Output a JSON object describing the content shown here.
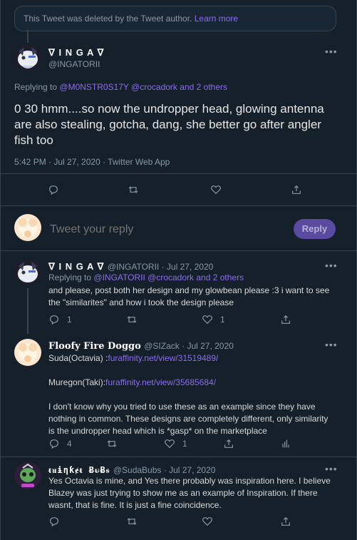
{
  "deleted_notice": {
    "text": "This Tweet was deleted by the Tweet author.",
    "link": "Learn more"
  },
  "main_tweet": {
    "display_name": "ᐁ I N G A ᐁ",
    "handle": "@INGATORII",
    "replying_prefix": "Replying to",
    "replying_users": "@M0NSTR0S17Y @crocadork",
    "replying_others": "and 2 others",
    "text": "0 30 hmm....so now the undropper head, glowing antenna are also stealing, gotcha, dang, she better go after angler fish too",
    "meta": "5:42 PM · Jul 27, 2020 · Twitter Web App"
  },
  "composer": {
    "placeholder": "Tweet your reply",
    "button": "Reply"
  },
  "replies": [
    {
      "display_name": "ᐁ I N G A ᐁ",
      "handle_date": "@INGATORII · Jul 27, 2020",
      "replying_prefix": "Replying to",
      "replying_users": "@INGATORII @crocadork",
      "replying_others": "and 2 others",
      "text": "and please, post both her design and my glowbean please :3 i want to see the \"similarites\" and how i took the design please",
      "reply_count": "1",
      "like_count": "1"
    },
    {
      "display_name": "Floofy Fire Doggo",
      "handle_date": "@SIZack · Jul 27, 2020",
      "line1_prefix": "Suda(Octavia) :",
      "line1_link": "furaffinity.net/view/31519489/",
      "line2_prefix": "Muregon(Taki):",
      "line2_link": "furaffinity.net/view/35685684/",
      "text": "I don't know why you tried to use these as an example since they have nothing in common. These designs are completely different, only similarity is the undropper head which is *gasp* on the marketplace",
      "reply_count": "4",
      "like_count": "1"
    },
    {
      "display_name": "ᵵᴚɨƞƙɇᵵ ɃᵾɃᵴ",
      "handle_date": "@SudaBubs · Jul 27, 2020",
      "text": "Yes Octavia is mine, and Yes there probably was inspiration here. I believe Blazey was just trying to show me as an example of Inspiration. If there wasnt, that is fine. It is just a fine coincidence."
    }
  ],
  "colors": {
    "background": "#15202b",
    "accent": "#8b6df0",
    "border": "#38444d",
    "muted": "#8899a6"
  }
}
